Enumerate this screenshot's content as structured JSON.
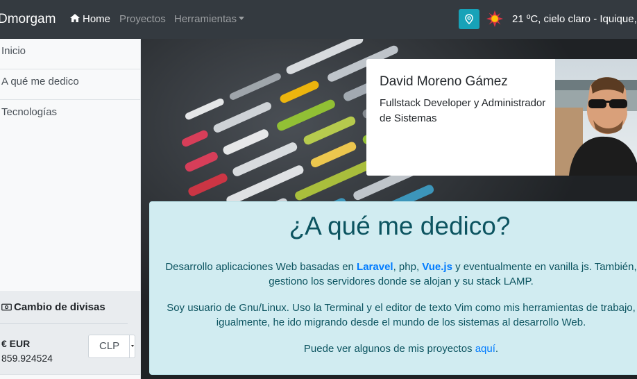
{
  "navbar": {
    "brand": "Dmorgam",
    "home": "Home",
    "projects": "Proyectos",
    "tools": "Herramientas",
    "weather": "21 ºC, cielo claro - Iquique,"
  },
  "sidebar": {
    "items": [
      {
        "label": "Inicio"
      },
      {
        "label": "A qué me dedico"
      },
      {
        "label": "Tecnologías"
      }
    ]
  },
  "currency": {
    "title": "Cambio de divisas",
    "code": "€ EUR",
    "value": "859.924524",
    "selected": "CLP"
  },
  "profile": {
    "name": "David Moreno Gámez",
    "role": "Fullstack Developer y Administrador de Sistemas"
  },
  "about": {
    "title": "¿A qué me dedico?",
    "p1_a": "Desarrollo aplicaciones Web basadas en ",
    "p1_laravel": "Laravel",
    "p1_b": ", php, ",
    "p1_vue": "Vue.js",
    "p1_c": " y eventualmente en vanilla js. También, gestiono los servidores donde se alojan y su stack LAMP.",
    "p2": "Soy usuario de Gnu/Linux. Uso la Terminal y el editor de texto Vim como mis herramientas de trabajo, igualmente, he ido migrando desde el mundo de los sistemas al desarrollo Web.",
    "p3_a": "Puede ver algunos de mis proyectos ",
    "p3_link": "aquí",
    "p3_b": "."
  },
  "colors": {
    "navbar": "#343a40",
    "accent_info": "#17a2b8",
    "link": "#007bff",
    "alert_bg": "#d1ecf1",
    "alert_text": "#0c5460"
  },
  "icons": [
    "home-icon",
    "map-marker-icon",
    "sun-icon",
    "money-icon"
  ]
}
